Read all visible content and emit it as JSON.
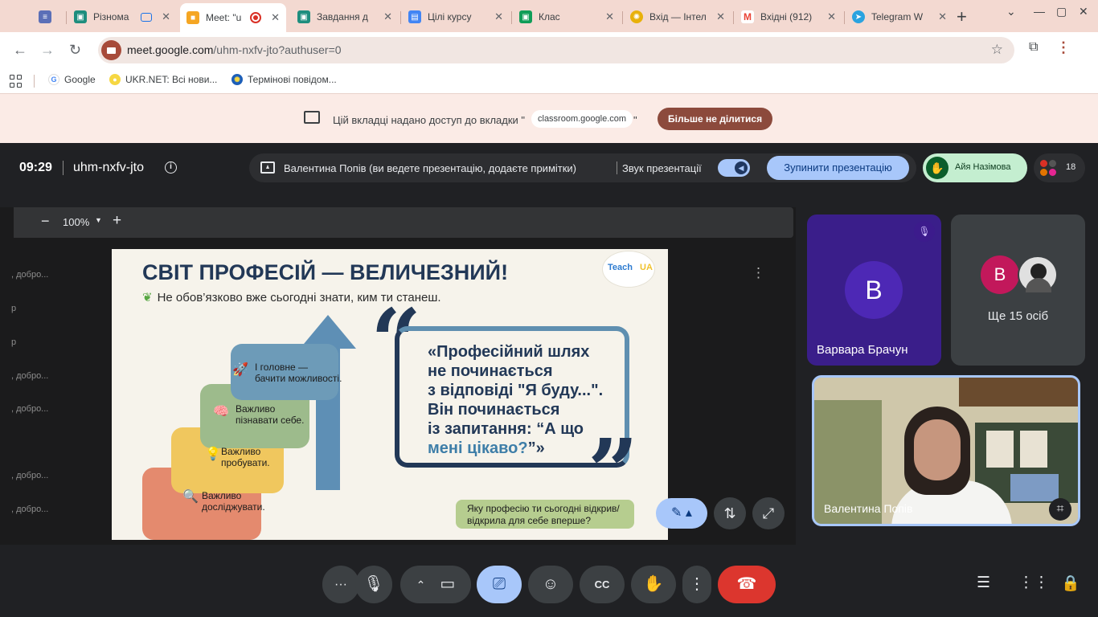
{
  "browser": {
    "tabs": [
      {
        "label": "",
        "icon": "layers-icon",
        "color": "#5b6fb7"
      },
      {
        "label": "Різнома",
        "icon": "classroom-icon",
        "color": "#1e8e7e"
      },
      {
        "label": "Meet: \"u",
        "icon": "meet-icon",
        "color": "#f5a623",
        "active": true
      },
      {
        "label": "Завдання д",
        "icon": "classroom-icon",
        "color": "#1e8e7e"
      },
      {
        "label": "Цілі курсу",
        "icon": "forms-icon",
        "color": "#4285f4"
      },
      {
        "label": "Клас",
        "icon": "classroom-icon",
        "color": "#0f9d58"
      },
      {
        "label": "Вхід — Інтел",
        "icon": "gear-icon",
        "color": "#e8b10a"
      },
      {
        "label": "Вхідні (912)",
        "icon": "gmail-icon",
        "color": "#ea4335"
      },
      {
        "label": "Telegram W",
        "icon": "telegram-icon",
        "color": "#2aa3e0"
      }
    ],
    "new_tab": "+",
    "url_host": "meet.google.com",
    "url_path": "/uhm-nxfv-jto?authuser=0",
    "bookmarks": [
      {
        "label": "Google",
        "icon": "google-icon"
      },
      {
        "label": "UKR.NET: Всі нови...",
        "icon": "ukrnet-icon"
      },
      {
        "label": "Термінові повідом...",
        "icon": "emblem-icon"
      }
    ]
  },
  "share_banner": {
    "text": "Цій вкладці надано доступ до вкладки \"",
    "chip": "classroom.google.com",
    "quote_close": "\"",
    "button": "Більше не ділитися"
  },
  "meet": {
    "time": "09:29",
    "code": "uhm-nxfv-jto",
    "presenting_text": "Валентина Попів (ви ведете презентацію, додаєте примітки)",
    "sound_label": "Звук презентації",
    "stop_presenting": "Зупинити презентацію",
    "hand_raised_name": "Айя Назімова",
    "participant_count": "18",
    "zoom": "100%",
    "doc_left_snippets": [
      ", добро...",
      "р",
      "р",
      ", добро...",
      ", добро...",
      ", добро...",
      ", добро..."
    ],
    "tiles": {
      "barbara": {
        "initial": "В",
        "name": "Варвара Брачун"
      },
      "more": {
        "initial": "В",
        "label": "Ще 15 осіб"
      },
      "self": {
        "name": "Валентина Попів"
      }
    }
  },
  "slide": {
    "title": "СВІТ ПРОФЕСІЙ — ВЕЛИЧЕЗНИЙ!",
    "subtitle": "Не обов’язково вже сьогодні знати, ким ти станеш.",
    "logo": "Teach",
    "logo_suffix": "UA",
    "steps": [
      {
        "line1": "Важливо",
        "line2": "досліджувати.",
        "color": "#e48a6e"
      },
      {
        "line1": "Важливо",
        "line2": "пробувати.",
        "color": "#f0c75e"
      },
      {
        "line1": "Важливо",
        "line2": "пізнавати себе.",
        "color": "#9dbb8c"
      },
      {
        "line1": "І головне —",
        "line2": "бачити можливості.",
        "color": "#6d9bb8"
      }
    ],
    "quote_open": "“",
    "quote_close": "”",
    "quote_lines": [
      "«Професійний шлях",
      "не починається",
      "з відповіді \"Я буду...\".",
      "Він починається",
      "із запитання: “А що"
    ],
    "quote_last_hl": "мені цікаво?",
    "quote_last_end": "”»",
    "question": "Яку професію ти сьогодні відкрив/відкрила для себе вперше?"
  },
  "colors": {
    "tabbar": "#f3d9d1",
    "meet_bg": "#202124",
    "accent_blue": "#a8c7fa",
    "end_call": "#dc362e"
  }
}
